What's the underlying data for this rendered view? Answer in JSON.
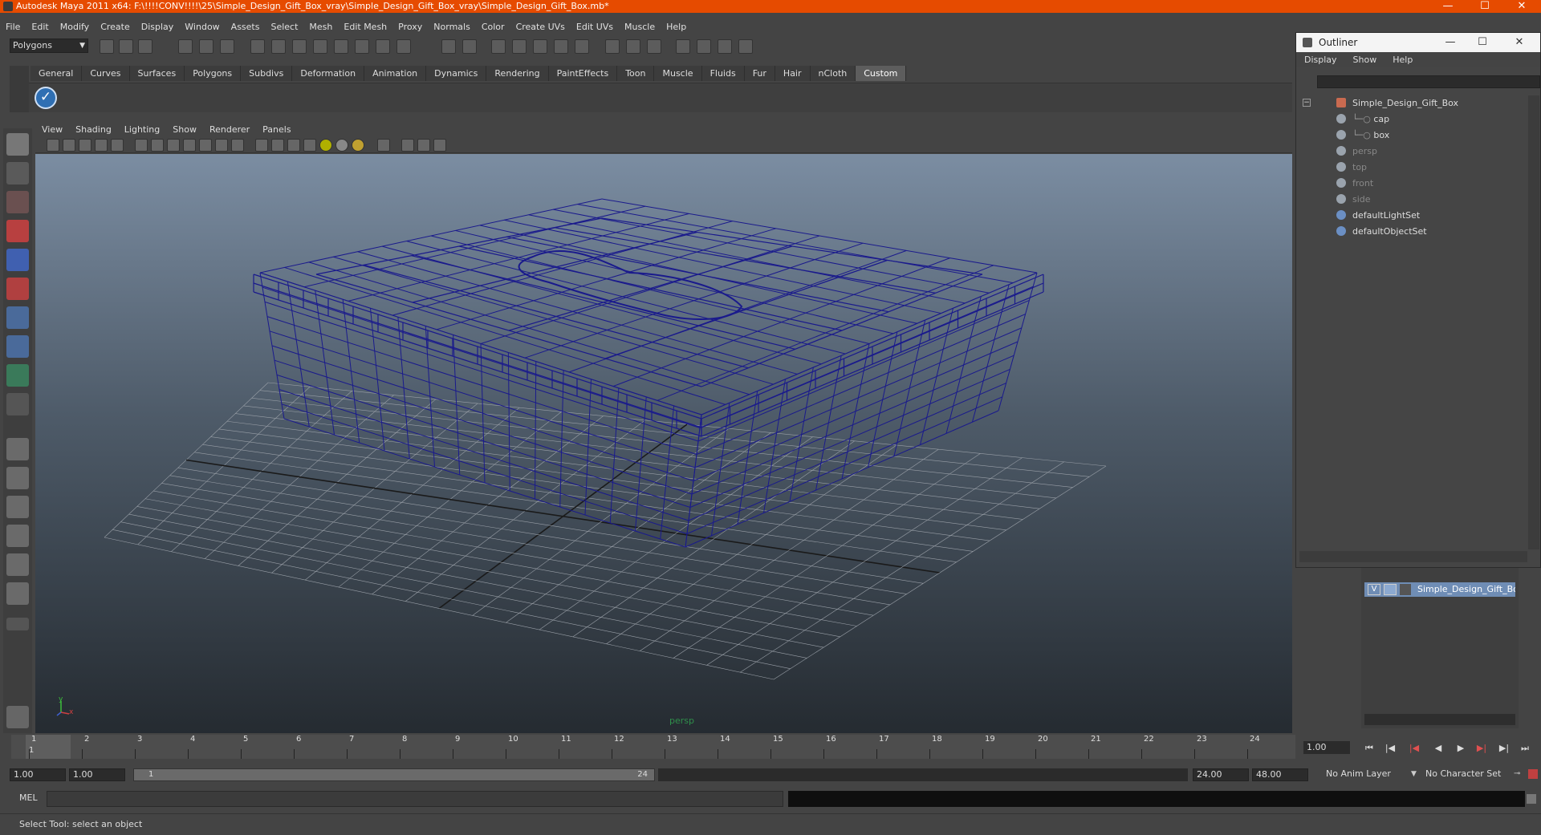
{
  "window": {
    "title": "Autodesk Maya 2011 x64: F:\\!!!!CONV!!!!\\25\\Simple_Design_Gift_Box_vray\\Simple_Design_Gift_Box_vray\\Simple_Design_Gift_Box.mb*",
    "minimize": "—",
    "maximize": "☐",
    "close": "✕"
  },
  "menubar": [
    "File",
    "Edit",
    "Modify",
    "Create",
    "Display",
    "Window",
    "Assets",
    "Select",
    "Mesh",
    "Edit Mesh",
    "Proxy",
    "Normals",
    "Color",
    "Create UVs",
    "Edit UVs",
    "Muscle",
    "Help"
  ],
  "statusline": {
    "mode": "Polygons"
  },
  "shelf": {
    "tabs": [
      "General",
      "Curves",
      "Surfaces",
      "Polygons",
      "Subdivs",
      "Deformation",
      "Animation",
      "Dynamics",
      "Rendering",
      "PaintEffects",
      "Toon",
      "Muscle",
      "Fluids",
      "Fur",
      "Hair",
      "nCloth",
      "Custom"
    ],
    "active_tab": "Custom",
    "check_icon": "✓"
  },
  "viewport": {
    "menu": [
      "View",
      "Shading",
      "Lighting",
      "Show",
      "Renderer",
      "Panels"
    ],
    "camera": "persp",
    "axis_y": "y",
    "axis_x": "x"
  },
  "outliner": {
    "title": "Outliner",
    "menu": [
      "Display",
      "Show",
      "Help"
    ],
    "items": [
      {
        "label": "Simple_Design_Gift_Box",
        "dim": false
      },
      {
        "label": "cap",
        "dim": false
      },
      {
        "label": "box",
        "dim": false
      },
      {
        "label": "persp",
        "dim": true
      },
      {
        "label": "top",
        "dim": true
      },
      {
        "label": "front",
        "dim": true
      },
      {
        "label": "side",
        "dim": true
      },
      {
        "label": "defaultLightSet",
        "dim": false
      },
      {
        "label": "defaultObjectSet",
        "dim": false
      }
    ]
  },
  "layers": {
    "visible_flag": "V",
    "layer_name": "Simple_Design_Gift_Box_"
  },
  "timeslider": {
    "ticks": [
      "1",
      "2",
      "3",
      "4",
      "5",
      "6",
      "7",
      "8",
      "9",
      "10",
      "11",
      "12",
      "13",
      "14",
      "15",
      "16",
      "17",
      "18",
      "19",
      "20",
      "21",
      "22",
      "23",
      "24"
    ],
    "current_frame_label": "1",
    "current_time": "1.00"
  },
  "rangeslider": {
    "start_time": "1.00",
    "playback_start": "1.00",
    "range_start_label": "1",
    "range_end_label": "24",
    "playback_end": "24.00",
    "end_time": "48.00",
    "anim_layer": "No Anim Layer",
    "character_set": "No Character Set"
  },
  "commandline": {
    "label": "MEL"
  },
  "helpline": {
    "text": "Select Tool: select an object"
  },
  "colors": {
    "titlebar": "#e64b00",
    "wireframe": "#1a1a8c",
    "grid": "#9aa0a8",
    "selected_layer": "#6f8db5"
  }
}
